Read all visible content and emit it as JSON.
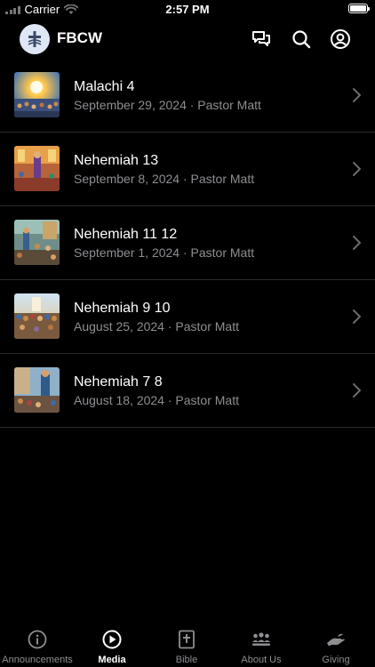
{
  "status_bar": {
    "carrier": "Carrier",
    "time": "2:57 PM"
  },
  "header": {
    "title": "FBCW"
  },
  "sermons": [
    {
      "title": "Malachi 4",
      "subtitle": "September 29, 2024 · Pastor Matt"
    },
    {
      "title": "Nehemiah 13",
      "subtitle": "September 8, 2024 · Pastor Matt"
    },
    {
      "title": "Nehemiah 11 12",
      "subtitle": "September 1, 2024 · Pastor Matt"
    },
    {
      "title": "Nehemiah 9 10",
      "subtitle": "August 25, 2024 · Pastor Matt"
    },
    {
      "title": "Nehemiah 7 8",
      "subtitle": "August 18, 2024 · Pastor Matt"
    }
  ],
  "tabs": [
    {
      "label": "Announcements",
      "icon": "info-icon"
    },
    {
      "label": "Media",
      "icon": "play-icon",
      "active": true
    },
    {
      "label": "Bible",
      "icon": "bible-icon"
    },
    {
      "label": "About Us",
      "icon": "people-icon"
    },
    {
      "label": "Giving",
      "icon": "giving-hand-icon"
    }
  ],
  "colors": {
    "background": "#000000",
    "secondary_text": "#8e8e93",
    "separator": "#2b2b2b"
  }
}
